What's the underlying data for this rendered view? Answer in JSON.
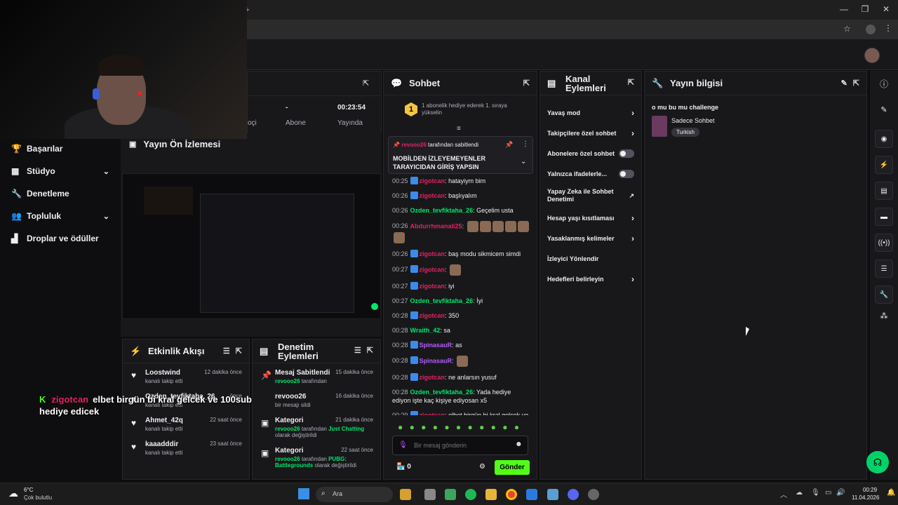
{
  "browser": {
    "new_tab": "+",
    "minimize": "—",
    "maximize": "❐",
    "close": "✕"
  },
  "nav": {
    "items": [
      {
        "label": "Başarılar",
        "icon": "trophy-icon"
      },
      {
        "label": "Stüdyo",
        "icon": "studio-icon",
        "chevron": "⌄"
      },
      {
        "label": "Denetleme",
        "icon": "wrench-icon"
      },
      {
        "label": "Topluluk",
        "icon": "community-icon",
        "chevron": "⌄"
      },
      {
        "label": "Droplar ve ödüller",
        "icon": "drops-icon"
      }
    ]
  },
  "stats": {
    "col1_label": "oçi",
    "col2_value": "-",
    "col2_label": "Abone",
    "col3_value": "00:23:54",
    "col3_label": "Yayında"
  },
  "preview": {
    "title": "Yayın Ön İzlemesi"
  },
  "activity": {
    "title": "Etkinlik Akışı",
    "items": [
      {
        "name": "Loostwind",
        "time": "12 dakika önce",
        "sub": "kanalı takip etti"
      },
      {
        "name": "Ozden_tevfiktaha_26",
        "time": "önce",
        "sub": "kanalı takip etti"
      },
      {
        "name": "Ahmet_42q",
        "time": "22 saat önce",
        "sub": "kanalı takip etti"
      },
      {
        "name": "kaaadddir",
        "time": "23 saat önce",
        "sub": "kanalı takip etti"
      }
    ]
  },
  "mod": {
    "title1": "Denetim",
    "title2": "Eylemleri",
    "items": [
      {
        "name": "Mesaj Sabitlendi",
        "time": "15 dakika önce",
        "user": "revooo26",
        "sub": "tarafından"
      },
      {
        "name": "revooo26",
        "time": "16 dakika önce",
        "user": "",
        "sub": "bir mesajı sildi"
      },
      {
        "name": "Kategori",
        "time": "21 dakika önce",
        "user": "revooo26",
        "sub": "tarafından",
        "value": "Just Chatting",
        "sub2": "olarak değiştirildi"
      },
      {
        "name": "Kategori",
        "time": "22 saat önce",
        "user": "revooo26",
        "sub": "tarafından",
        "value": "PUBG: Battlegrounds",
        "sub2": "olarak değiştirildi"
      }
    ]
  },
  "chat": {
    "title": "Sohbet",
    "gift_rank": "1",
    "gift_text": "1 abonelik hediye ederek 1. sıraya yükselin",
    "pinned_by": "revooo26",
    "pinned_suffix": "tarafından sabitlendi",
    "pinned_msg": "MOBİLDEN İZLEYEMEYENLER TARAYICIDAN GİRİŞ YAPSIN",
    "messages": [
      {
        "time": "00:25",
        "user": "zigotcan",
        "color": "#e0245e",
        "text": "hatayiym bim",
        "badge": true
      },
      {
        "time": "00:26",
        "user": "zigotcan",
        "color": "#e0245e",
        "text": "başlıyalım",
        "badge": true
      },
      {
        "time": "00:26",
        "user": "Ozden_tevfiktaha_26",
        "color": "#00e86b",
        "text": "Geçelim usta",
        "badge": false
      },
      {
        "time": "00:26",
        "user": "Abdurrhmanali25",
        "color": "#e0245e",
        "text": "",
        "badge": false,
        "emotes": 6
      },
      {
        "time": "00:26",
        "user": "zigotcan",
        "color": "#e0245e",
        "text": "baş modu sikmicem simdi",
        "badge": true
      },
      {
        "time": "00:27",
        "user": "zigotcan",
        "color": "#e0245e",
        "text": "",
        "badge": true,
        "emotes": 1
      },
      {
        "time": "00:27",
        "user": "zigotcan",
        "color": "#e0245e",
        "text": "iyi",
        "badge": true
      },
      {
        "time": "00:27",
        "user": "Ozden_tevfiktaha_26",
        "color": "#00e86b",
        "text": "İyi",
        "badge": false
      },
      {
        "time": "00:28",
        "user": "zigotcan",
        "color": "#e0245e",
        "text": "350",
        "badge": true
      },
      {
        "time": "00:28",
        "user": "Wraith_42",
        "color": "#00e86b",
        "text": "sa",
        "badge": false
      },
      {
        "time": "00:28",
        "user": "SpinasauR",
        "color": "#b45cff",
        "text": "as",
        "badge": true
      },
      {
        "time": "00:28",
        "user": "SpinasauR",
        "color": "#b45cff",
        "text": "",
        "badge": true,
        "emotes": 1
      },
      {
        "time": "00:28",
        "user": "zigotcan",
        "color": "#e0245e",
        "text": "ne anlarsın yusuf",
        "badge": true
      },
      {
        "time": "00:28",
        "user": "Ozden_tevfiktaha_26",
        "color": "#00e86b",
        "text": "Yada hediye ediyon işte kaç kişiye ediyosan x5",
        "badge": false
      },
      {
        "time": "00:29",
        "user": "zigotcan",
        "color": "#e0245e",
        "text": "elbet birgün bi kral gelcek ve 100sub hediye edicek",
        "badge": true
      }
    ],
    "input_placeholder": "Bir mesaj gönderin",
    "points": "0",
    "send_label": "Gönder"
  },
  "channel_actions": {
    "title1": "Kanal",
    "title2": "Eylemleri",
    "items": [
      {
        "label": "Yavaş mod",
        "type": "arrow"
      },
      {
        "label": "Takipçilere özel sohbet",
        "type": "arrow"
      },
      {
        "label": "Abonelere özel sohbet",
        "type": "toggle"
      },
      {
        "label": "Yalnızca ifadelerle...",
        "type": "toggle"
      },
      {
        "label": "Yapay Zeka ile Sohbet Denetimi",
        "type": "external"
      },
      {
        "label": "Hesap yaşı kısıtlaması",
        "type": "arrow"
      },
      {
        "label": "Yasaklanmış kelimeler",
        "type": "arrow"
      },
      {
        "label": "İzleyici Yönlendir",
        "type": "none"
      },
      {
        "label": "Hedefleri belirleyin",
        "type": "arrow"
      }
    ]
  },
  "stream_info": {
    "title": "Yayın bilgisi",
    "stream_title": "o mu bu mu challenge",
    "category": "Sadece Sohbet",
    "tag": "Turkish"
  },
  "overlay": {
    "user": "zigotcan",
    "text": "elbet birgün bi kral gelcek ve 100sub hediye edicek"
  },
  "taskbar": {
    "temp": "6°C",
    "weather": "Çok bulutlu",
    "search_label": "Ara",
    "time": "00:29",
    "date": "11.04.2026"
  },
  "colors": {
    "accent": "#53fc18",
    "panel": "#18181b",
    "bg": "#0e0e10"
  }
}
